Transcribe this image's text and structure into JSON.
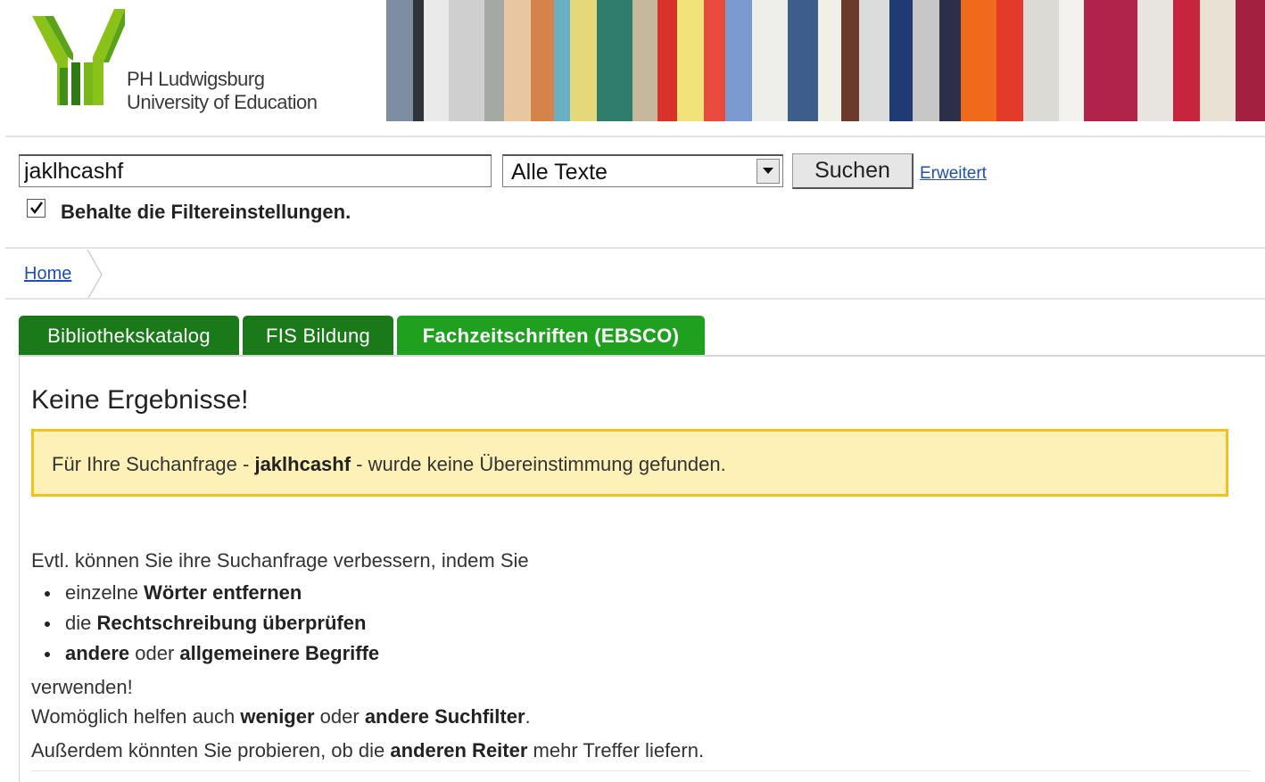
{
  "header": {
    "logo_line1": "PH Ludwigsburg",
    "logo_line2": "University of Education"
  },
  "search": {
    "query": "jaklhcashf",
    "scope_selected": "Alle Texte",
    "submit_label": "Suchen",
    "advanced_label": "Erweitert",
    "keep_filters_checked": true,
    "keep_filters_label": "Behalte die Filtereinstellungen."
  },
  "breadcrumb": {
    "home_label": "Home"
  },
  "tabs": [
    {
      "label": "Bibliothekskatalog",
      "active": false
    },
    {
      "label": "FIS Bildung",
      "active": false
    },
    {
      "label": "Fachzeitschriften (EBSCO)",
      "active": true
    }
  ],
  "results": {
    "heading": "Keine Ergebnisse!",
    "notice_prefix": "Für Ihre Suchanfrage - ",
    "notice_query": "jaklhcashf",
    "notice_suffix": " - wurde keine Übereinstimmung gefunden.",
    "intro": "Evtl. können Sie ihre Suchanfrage verbessern, indem Sie",
    "tips": [
      {
        "pre": "einzelne ",
        "b1": "Wörter entfernen",
        "mid": "",
        "b2": ""
      },
      {
        "pre": "die ",
        "b1": "Rechtschreibung überprüfen",
        "mid": "",
        "b2": ""
      },
      {
        "pre": "",
        "b1": "andere",
        "mid": " oder ",
        "b2": "allgemeinere Begriffe"
      }
    ],
    "outro": "verwenden!",
    "hint1_pre": "Womöglich helfen auch ",
    "hint1_b1": "weniger",
    "hint1_mid": " oder ",
    "hint1_b2": "andere Suchfilter",
    "hint1_post": ".",
    "hint2_pre": "Außerdem könnten Sie probieren, ob die ",
    "hint2_b": "anderen Reiter",
    "hint2_post": " mehr Treffer liefern."
  },
  "colors": {
    "tab_green": "#1a7a1a",
    "tab_active_green": "#1fa01f",
    "notice_bg": "#fdf1b8",
    "notice_border": "#f1c21c",
    "link_blue": "#1f4fb0"
  }
}
